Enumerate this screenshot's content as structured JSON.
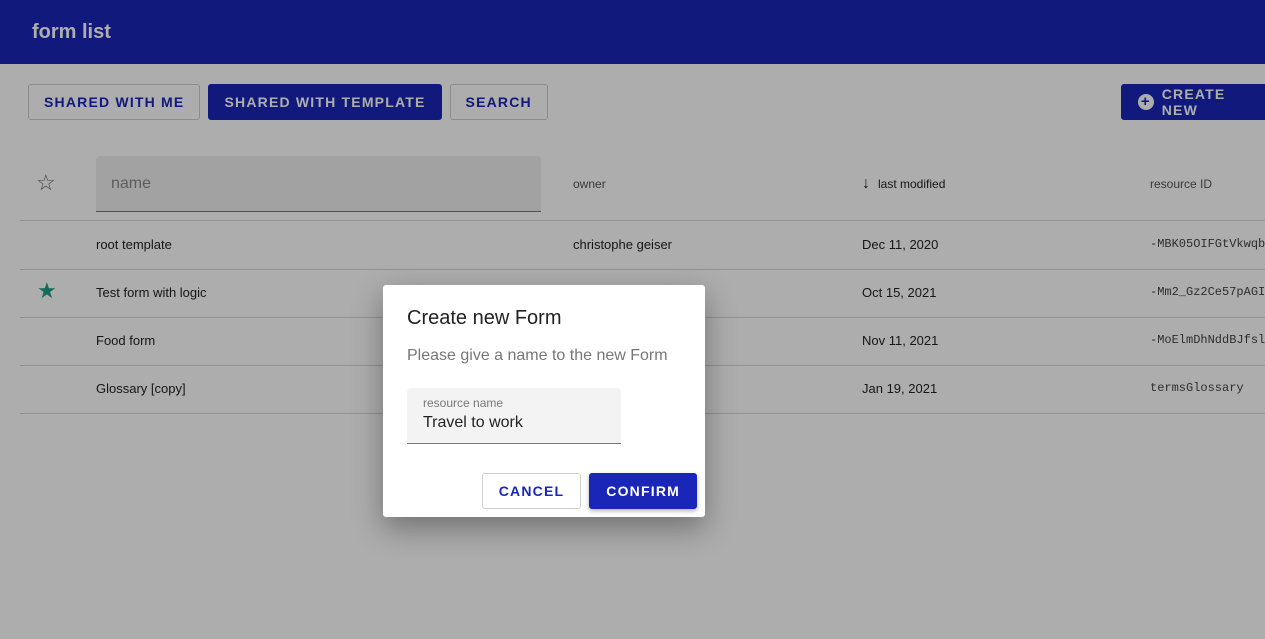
{
  "appbar": {
    "title": "form list"
  },
  "toolbar": {
    "shared_with_me": "SHARED WITH ME",
    "shared_with_template": "SHARED WITH TEMPLATE",
    "search": "SEARCH",
    "create_new": "CREATE NEW"
  },
  "table": {
    "name_placeholder": "name",
    "columns": {
      "owner": "owner",
      "last_modified": "last modified",
      "resource_id": "resource ID"
    },
    "sort_icon": "arrow-down-icon",
    "rows": [
      {
        "starred": false,
        "name": "root template",
        "owner": "christophe geiser",
        "last_modified": "Dec 11, 2020",
        "resource_id": "-MBK05OIFGtVkwqb"
      },
      {
        "starred": true,
        "name": "Test form with logic",
        "owner": "",
        "last_modified": "Oct 15, 2021",
        "resource_id": "-Mm2_Gz2Ce57pAGI"
      },
      {
        "starred": false,
        "name": "Food form",
        "owner": "",
        "last_modified": "Nov 11, 2021",
        "resource_id": "-MoElmDhNddBJfsl"
      },
      {
        "starred": false,
        "name": "Glossary [copy]",
        "owner": "",
        "last_modified": "Jan 19, 2021",
        "resource_id": "termsGlossary"
      }
    ]
  },
  "dialog": {
    "title": "Create new Form",
    "text": "Please give a name to the new Form",
    "field_label": "resource name",
    "field_value": "Travel to work",
    "cancel": "CANCEL",
    "confirm": "CONFIRM"
  },
  "colors": {
    "primary": "#1a26b8",
    "star": "#1b9e8a"
  }
}
